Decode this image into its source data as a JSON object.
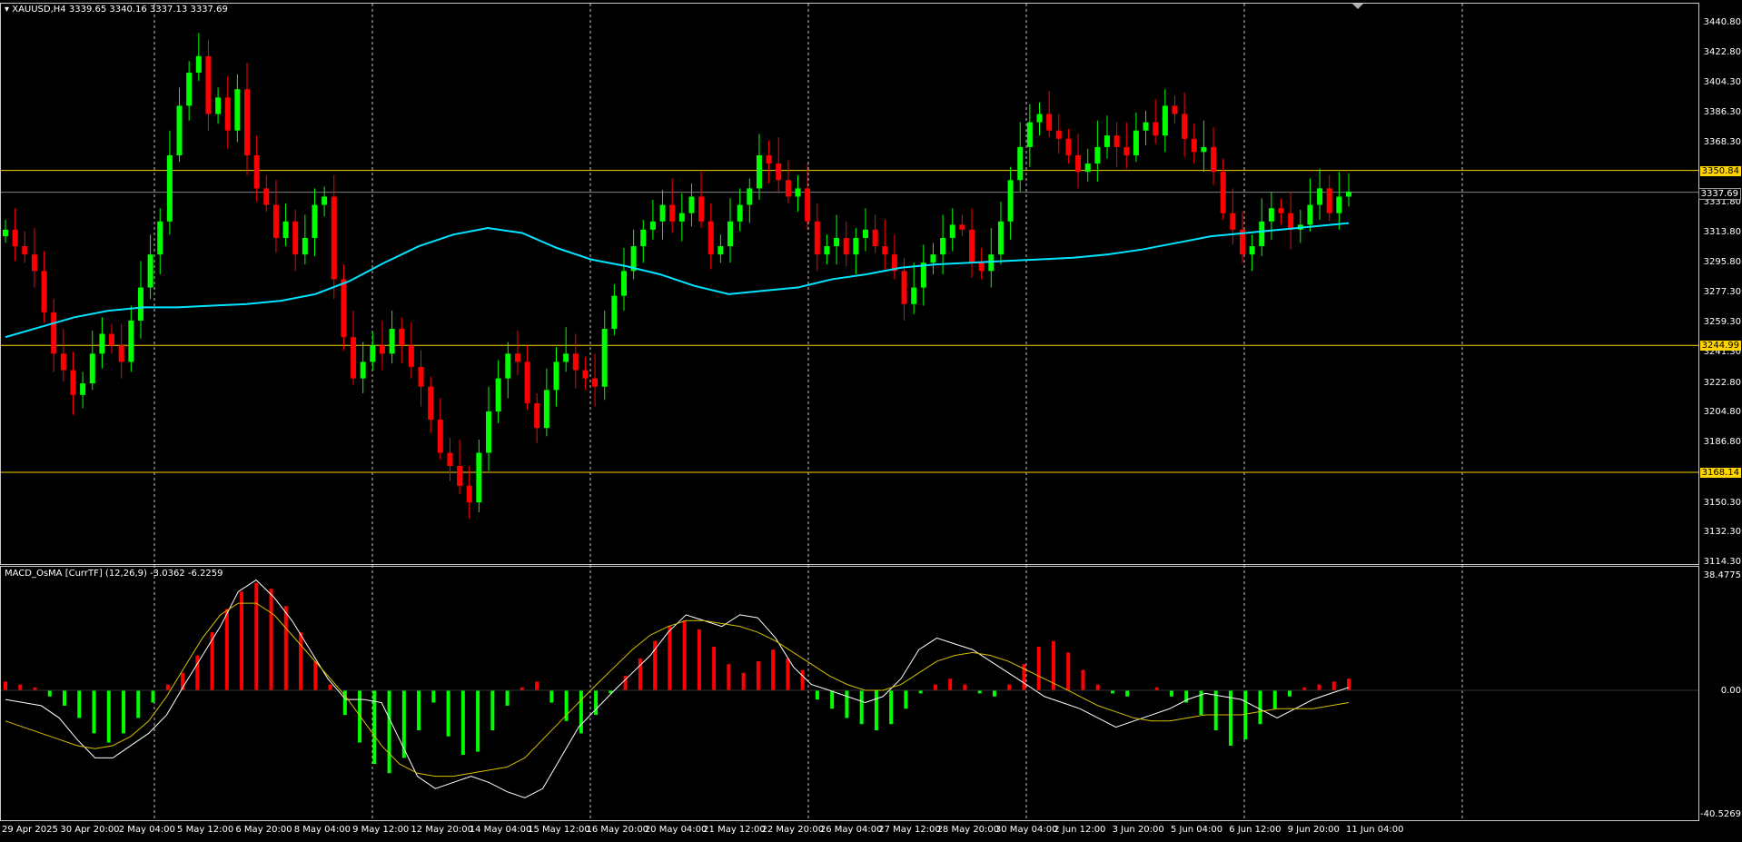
{
  "header": {
    "symbol_label": "XAUUSD,H4",
    "ohlc": "3339.65 3340.16 3337.13 3337.69"
  },
  "indicator": {
    "label": "MACD_OsMA [CurrTF] (12,26,9) -3.0362 -6.2259",
    "scale_top": "38.4775",
    "scale_zero": "0.00",
    "scale_bottom": "-40.5269"
  },
  "price_axis": [
    "3440.80",
    "3422.80",
    "3404.30",
    "3386.30",
    "3368.30",
    "3331.80",
    "3313.80",
    "3295.80",
    "3277.30",
    "3259.30",
    "3241.30",
    "3222.80",
    "3204.80",
    "3186.80",
    "3168.30",
    "3150.30",
    "3132.30",
    "3114.30"
  ],
  "hlines": [
    {
      "label": "3350.84",
      "price": 3350.84
    },
    {
      "label": "3244.99",
      "price": 3244.99
    },
    {
      "label": "3168.14",
      "price": 3168.14
    }
  ],
  "current_price": {
    "label": "3337.69",
    "price": 3337.69
  },
  "time_axis": [
    "29 Apr 2025",
    "30 Apr 20:00",
    "2 May 04:00",
    "5 May 12:00",
    "6 May 20:00",
    "8 May 04:00",
    "9 May 12:00",
    "12 May 20:00",
    "14 May 04:00",
    "15 May 12:00",
    "16 May 20:00",
    "20 May 04:00",
    "21 May 12:00",
    "22 May 20:00",
    "26 May 04:00",
    "27 May 12:00",
    "28 May 20:00",
    "30 May 04:00",
    "2 Jun 12:00",
    "3 Jun 20:00",
    "5 Jun 04:00",
    "6 Jun 12:00",
    "9 Jun 20:00",
    "11 Jun 04:00"
  ],
  "colors": {
    "background": "#000000",
    "bull": "#00ff00",
    "bear": "#ff0000",
    "ma": "#00e5ff",
    "hline": "#ffd400",
    "grid": "#c8c8c8",
    "macd": "#ffffff",
    "signal": "#d4c000"
  },
  "chart_data": {
    "type": "candlestick",
    "symbol": "XAUUSD",
    "timeframe": "H4",
    "ylim": [
      3114.3,
      3440.8
    ],
    "close_path": [
      3315,
      3305,
      3300,
      3290,
      3265,
      3240,
      3230,
      3215,
      3222,
      3240,
      3252,
      3245,
      3235,
      3260,
      3280,
      3300,
      3320,
      3360,
      3390,
      3410,
      3420,
      3385,
      3395,
      3375,
      3400,
      3360,
      3340,
      3330,
      3310,
      3320,
      3300,
      3310,
      3330,
      3335,
      3285,
      3250,
      3225,
      3235,
      3245,
      3240,
      3255,
      3245,
      3232,
      3220,
      3200,
      3180,
      3172,
      3160,
      3150,
      3180,
      3205,
      3225,
      3240,
      3235,
      3210,
      3195,
      3218,
      3235,
      3240,
      3230,
      3225,
      3220,
      3255,
      3275,
      3290,
      3305,
      3315,
      3320,
      3330,
      3320,
      3325,
      3335,
      3320,
      3300,
      3305,
      3320,
      3330,
      3340,
      3360,
      3355,
      3345,
      3335,
      3340,
      3320,
      3300,
      3305,
      3310,
      3300,
      3310,
      3315,
      3305,
      3300,
      3290,
      3270,
      3280,
      3295,
      3300,
      3310,
      3318,
      3315,
      3295,
      3290,
      3300,
      3320,
      3345,
      3365,
      3380,
      3385,
      3375,
      3370,
      3360,
      3350,
      3355,
      3365,
      3372,
      3365,
      3360,
      3375,
      3380,
      3372,
      3390,
      3385,
      3370,
      3362,
      3365,
      3350,
      3325,
      3315,
      3300,
      3305,
      3320,
      3328,
      3325,
      3315,
      3318,
      3330,
      3340,
      3325,
      3335,
      3338
    ],
    "ma": [
      3250,
      3256,
      3262,
      3266,
      3268,
      3268,
      3269,
      3270,
      3272,
      3276,
      3284,
      3295,
      3305,
      3312,
      3316,
      3313,
      3304,
      3297,
      3293,
      3288,
      3281,
      3276,
      3278,
      3280,
      3285,
      3288,
      3292,
      3294,
      3295,
      3296,
      3297,
      3298,
      3300,
      3303,
      3307,
      3311,
      3313,
      3315,
      3317,
      3319
    ],
    "markers": [
      {
        "date": "29 Apr 2025",
        "close": 3315
      },
      {
        "date": "30 Apr 20:00",
        "close": 3235
      },
      {
        "date": "2 May 04:00",
        "close": 3222
      },
      {
        "date": "5 May 12:00",
        "close": 3330
      },
      {
        "date": "6 May 20:00",
        "close": 3420
      },
      {
        "date": "8 May 04:00",
        "close": 3330
      },
      {
        "date": "9 May 12:00",
        "close": 3325
      },
      {
        "date": "12 May 20:00",
        "close": 3235
      },
      {
        "date": "14 May 04:00",
        "close": 3180
      },
      {
        "date": "15 May 12:00",
        "close": 3205
      },
      {
        "date": "16 May 20:00",
        "close": 3235
      },
      {
        "date": "20 May 04:00",
        "close": 3280
      },
      {
        "date": "21 May 12:00",
        "close": 3330
      },
      {
        "date": "22 May 20:00",
        "close": 3335
      },
      {
        "date": "26 May 04:00",
        "close": 3340
      },
      {
        "date": "27 May 12:00",
        "close": 3305
      },
      {
        "date": "28 May 20:00",
        "close": 3290
      },
      {
        "date": "30 May 04:00",
        "close": 3300
      },
      {
        "date": "2 Jun 12:00",
        "close": 3385
      },
      {
        "date": "3 Jun 20:00",
        "close": 3365
      },
      {
        "date": "5 Jun 04:00",
        "close": 3380
      },
      {
        "date": "6 Jun 12:00",
        "close": 3305
      },
      {
        "date": "9 Jun 20:00",
        "close": 3325
      },
      {
        "date": "11 Jun 04:00",
        "close": 3338
      }
    ],
    "osma_series": [
      3,
      2,
      1,
      -2,
      -5,
      -9,
      -14,
      -17,
      -14,
      -9,
      -4,
      2,
      6,
      12,
      20,
      28,
      34,
      37,
      35,
      29,
      20,
      10,
      2,
      -8,
      -17,
      -24,
      -27,
      -22,
      -13,
      -4,
      -15,
      -21,
      -20,
      -13,
      -5,
      1,
      3,
      -4,
      -10,
      -14,
      -8,
      -1,
      5,
      11,
      17,
      22,
      24,
      21,
      15,
      9,
      6,
      10,
      14,
      11,
      7,
      -3,
      -6,
      -9,
      -11,
      -13,
      -11,
      -6,
      -1,
      2,
      4,
      2,
      -1,
      -2,
      2,
      9,
      15,
      17,
      13,
      7,
      2,
      -1,
      -2,
      0,
      1,
      -2,
      -4,
      -8,
      -13,
      -18,
      -16,
      -11,
      -6,
      -2,
      1,
      2,
      3,
      4
    ],
    "macd_series": [
      -3,
      -4,
      -5,
      -9,
      -16,
      -22,
      -22,
      -18,
      -14,
      -8,
      2,
      12,
      22,
      34,
      38,
      32,
      24,
      14,
      4,
      -3,
      -3,
      -4,
      -16,
      -28,
      -32,
      -30,
      -28,
      -30,
      -33,
      -35,
      -32,
      -22,
      -12,
      -6,
      0,
      6,
      12,
      20,
      26,
      24,
      22,
      26,
      25,
      18,
      8,
      2,
      0,
      -2,
      -4,
      -2,
      4,
      14,
      18,
      16,
      14,
      10,
      6,
      2,
      -2,
      -4,
      -6,
      -9,
      -12,
      -10,
      -8,
      -6,
      -3,
      -1,
      -2,
      -3,
      -6,
      -9,
      -6,
      -3,
      -1,
      1
    ],
    "signal_series": [
      -10,
      -12,
      -14,
      -16,
      -18,
      -19,
      -18,
      -15,
      -10,
      -2,
      8,
      18,
      26,
      30,
      30,
      26,
      19,
      12,
      5,
      -2,
      -10,
      -18,
      -24,
      -27,
      -28,
      -28,
      -27,
      -26,
      -25,
      -22,
      -16,
      -10,
      -4,
      2,
      8,
      14,
      19,
      22,
      24,
      24,
      23,
      22,
      20,
      17,
      13,
      9,
      5,
      2,
      0,
      0,
      2,
      6,
      10,
      12,
      13,
      12,
      10,
      7,
      4,
      1,
      -2,
      -5,
      -7,
      -9,
      -10,
      -10,
      -9,
      -8,
      -8,
      -8,
      -7,
      -6,
      -6,
      -6,
      -5,
      -4
    ]
  }
}
